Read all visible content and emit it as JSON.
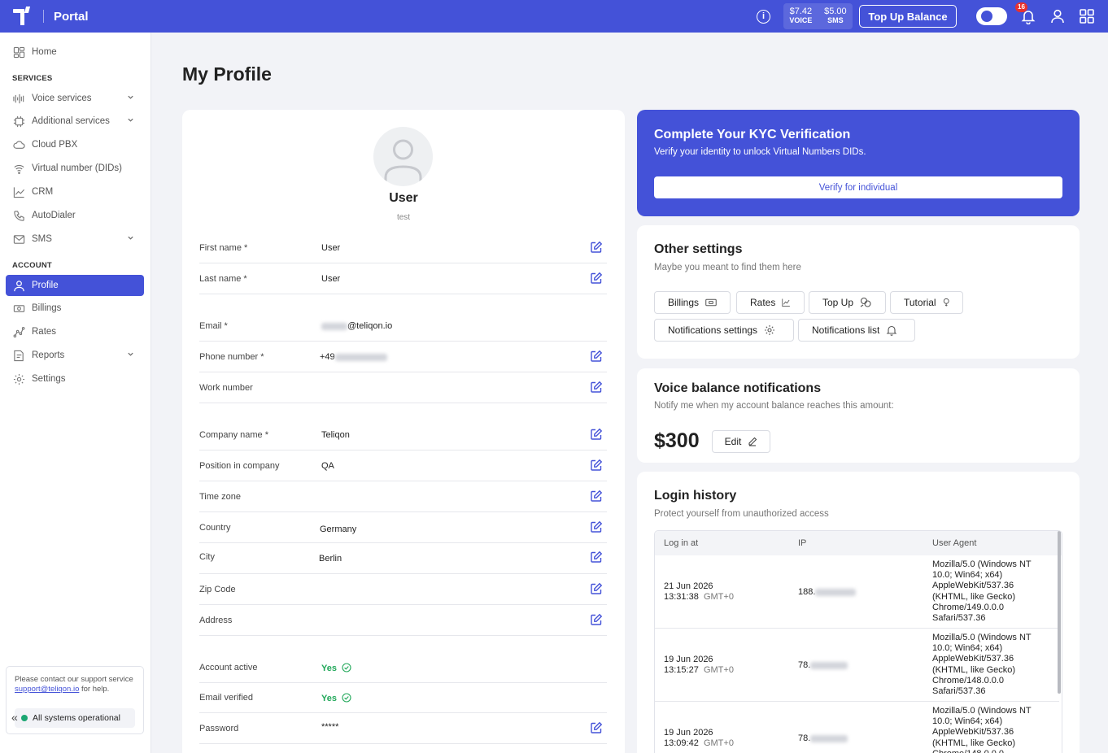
{
  "header": {
    "app_name": "Portal",
    "voice_balance": "$7.42",
    "voice_label": "VOICE",
    "sms_balance": "$5.00",
    "sms_label": "SMS",
    "topup_label": "Top Up Balance",
    "notification_count": "16",
    "accent_color": "#4452d8"
  },
  "sidebar": {
    "home": "Home",
    "services_heading": "SERVICES",
    "services": [
      {
        "label": "Voice services",
        "icon": "waveform-icon",
        "expandable": true
      },
      {
        "label": "Additional services",
        "icon": "chip-icon",
        "expandable": true
      },
      {
        "label": "Cloud PBX",
        "icon": "cloud-icon",
        "expandable": false
      },
      {
        "label": "Virtual number (DIDs)",
        "icon": "signal-icon",
        "expandable": false
      },
      {
        "label": "CRM",
        "icon": "chart-icon",
        "expandable": false
      },
      {
        "label": "AutoDialer",
        "icon": "phone-icon",
        "expandable": false
      },
      {
        "label": "SMS",
        "icon": "mail-icon",
        "expandable": true
      }
    ],
    "account_heading": "ACCOUNT",
    "account": [
      {
        "label": "Profile",
        "icon": "user-icon",
        "active": true
      },
      {
        "label": "Billings",
        "icon": "banknote-icon"
      },
      {
        "label": "Rates",
        "icon": "rates-icon"
      },
      {
        "label": "Reports",
        "icon": "report-icon",
        "expandable": true
      },
      {
        "label": "Settings",
        "icon": "gear-icon"
      }
    ],
    "support_text_1": "Please contact our support service",
    "support_email": "support@teliqon.io",
    "support_text_2": "for help.",
    "status": "All systems operational",
    "collapse": "«"
  },
  "page": {
    "title": "My Profile"
  },
  "profile": {
    "name": "User",
    "subtitle": "test",
    "fields": {
      "first_name": {
        "label": "First name *",
        "value": "User"
      },
      "last_name": {
        "label": "Last name *",
        "value": "User"
      },
      "email": {
        "label": "Email *",
        "value": "@teliqon.io"
      },
      "phone": {
        "label": "Phone number *",
        "value": "+49"
      },
      "work": {
        "label": "Work number",
        "value": ""
      },
      "company": {
        "label": "Company name *",
        "value": "Teliqon"
      },
      "position": {
        "label": "Position in company",
        "value": "QA"
      },
      "timezone": {
        "label": "Time zone",
        "value": ""
      },
      "country": {
        "label": "Country",
        "value": "Germany"
      },
      "city": {
        "label": "City",
        "value": "Berlin"
      },
      "zip": {
        "label": "Zip Code",
        "value": ""
      },
      "address": {
        "label": "Address",
        "value": ""
      },
      "account_active": {
        "label": "Account active",
        "value": "Yes"
      },
      "email_verified": {
        "label": "Email verified",
        "value": "Yes"
      },
      "password": {
        "label": "Password",
        "value": "*****"
      }
    }
  },
  "kyc": {
    "title": "Complete Your KYC Verification",
    "subtitle": "Verify your identity to unlock Virtual Numbers DIDs.",
    "button": "Verify for individual"
  },
  "other_settings": {
    "title": "Other settings",
    "subtitle": "Maybe you meant to find them here",
    "links": {
      "billings": "Billings",
      "rates": "Rates",
      "topup": "Top Up",
      "tutorial": "Tutorial",
      "notif_settings": "Notifications settings",
      "notif_list": "Notifications list"
    }
  },
  "voice_notifications": {
    "title": "Voice balance notifications",
    "subtitle": "Notify me when my account balance reaches this amount:",
    "amount": "$300",
    "edit": "Edit"
  },
  "login_history": {
    "title": "Login history",
    "subtitle": "Protect yourself from unauthorized access",
    "columns": [
      "Log in at",
      "IP",
      "User Agent"
    ],
    "rows": [
      {
        "date": "21 Jun 2026",
        "time": "13:31:38",
        "tz": "GMT+0",
        "ip": "188.",
        "ua": "Mozilla/5.0 (Windows NT 10.0; Win64; x64) AppleWebKit/537.36 (KHTML, like Gecko) Chrome/149.0.0.0 Safari/537.36"
      },
      {
        "date": "19 Jun 2026",
        "time": "13:15:27",
        "tz": "GMT+0",
        "ip": "78.",
        "ua": "Mozilla/5.0 (Windows NT 10.0; Win64; x64) AppleWebKit/537.36 (KHTML, like Gecko) Chrome/148.0.0.0 Safari/537.36"
      },
      {
        "date": "19 Jun 2026",
        "time": "13:09:42",
        "tz": "GMT+0",
        "ip": "78.",
        "ua": "Mozilla/5.0 (Windows NT 10.0; Win64; x64) AppleWebKit/537.36 (KHTML, like Gecko) Chrome/148.0.0.0"
      }
    ]
  }
}
